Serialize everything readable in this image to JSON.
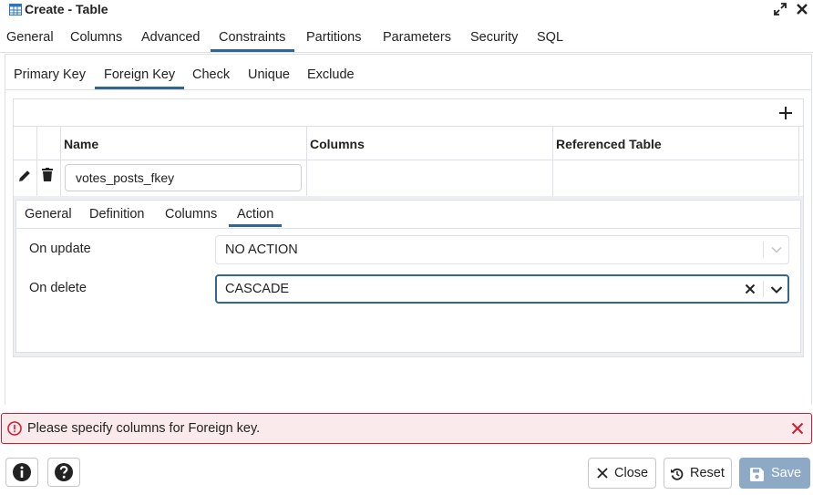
{
  "window": {
    "title": "Create - Table"
  },
  "tabs": [
    "General",
    "Columns",
    "Advanced",
    "Constraints",
    "Partitions",
    "Parameters",
    "Security",
    "SQL"
  ],
  "active_tab": "Constraints",
  "subtabs": [
    "Primary Key",
    "Foreign Key",
    "Check",
    "Unique",
    "Exclude"
  ],
  "active_subtab": "Foreign Key",
  "grid": {
    "columns": [
      "Name",
      "Columns",
      "Referenced Table"
    ],
    "rows": [
      {
        "name": "votes_posts_fkey",
        "columns": "",
        "referenced_table": ""
      }
    ]
  },
  "detail": {
    "tabs": [
      "General",
      "Definition",
      "Columns",
      "Action"
    ],
    "active_tab": "Action",
    "on_update_label": "On update",
    "on_update_value": "NO ACTION",
    "on_delete_label": "On delete",
    "on_delete_value": "CASCADE"
  },
  "error": {
    "message": "Please specify columns for Foreign key."
  },
  "footer": {
    "close_label": "Close",
    "reset_label": "Reset",
    "save_label": "Save"
  },
  "colors": {
    "accent": "#326690",
    "error": "#d41c31",
    "error_bg": "#fbeaec",
    "save_bg": "#8ea9c5"
  }
}
